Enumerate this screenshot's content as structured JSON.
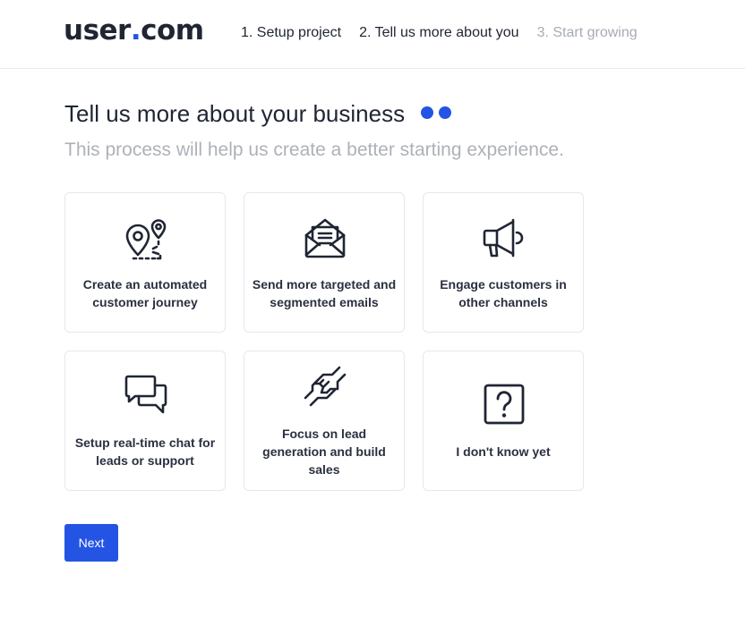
{
  "header": {
    "logo_text": "user",
    "logo_dot": ".",
    "logo_suffix": "com",
    "steps": [
      {
        "label": "1. Setup project",
        "state": "done"
      },
      {
        "label": "2. Tell us more about you",
        "state": "active"
      },
      {
        "label": "3. Start growing",
        "state": "inactive"
      }
    ]
  },
  "main": {
    "title": "Tell us more about your business",
    "subtitle": "This process will help us create a better starting experience.",
    "options": [
      {
        "label": "Create an automated customer journey",
        "icon": "journey-icon"
      },
      {
        "label": "Send more targeted and segmented emails",
        "icon": "email-icon"
      },
      {
        "label": "Engage customers in other channels",
        "icon": "megaphone-icon"
      },
      {
        "label": "Setup real-time chat for leads or support",
        "icon": "chat-icon"
      },
      {
        "label": "Focus on lead generation and build sales",
        "icon": "handshake-icon"
      },
      {
        "label": "I don't know yet",
        "icon": "question-icon"
      }
    ],
    "next_label": "Next"
  },
  "colors": {
    "accent": "#2454e3",
    "text": "#1f2533",
    "muted": "#aeb1b9",
    "border": "#e6e8ec"
  }
}
